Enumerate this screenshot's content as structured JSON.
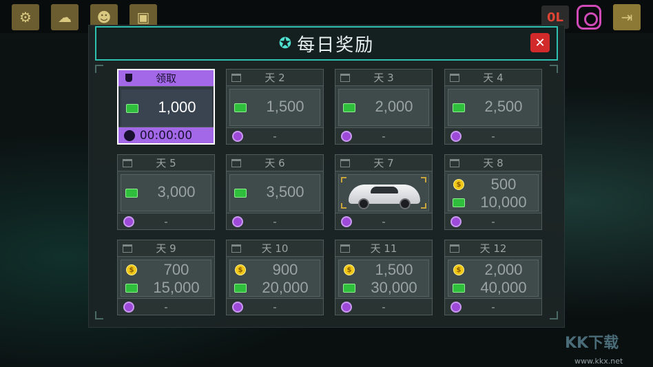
{
  "title": "每日奖励",
  "top_bar": {
    "counter_text": "0L"
  },
  "cards": [
    {
      "label": "领取",
      "amounts": [
        "1,000"
      ],
      "foot": "00:00:00"
    },
    {
      "label": "天 2",
      "amounts": [
        "1,500"
      ],
      "foot": "-"
    },
    {
      "label": "天 3",
      "amounts": [
        "2,000"
      ],
      "foot": "-"
    },
    {
      "label": "天 4",
      "amounts": [
        "2,500"
      ],
      "foot": "-"
    },
    {
      "label": "天 5",
      "amounts": [
        "3,000"
      ],
      "foot": "-"
    },
    {
      "label": "天 6",
      "amounts": [
        "3,500"
      ],
      "foot": "-"
    },
    {
      "label": "天 7",
      "amounts": [],
      "foot": "-"
    },
    {
      "label": "天 8",
      "amounts": [
        "500",
        "10,000"
      ],
      "foot": "-"
    },
    {
      "label": "天 9",
      "amounts": [
        "700",
        "15,000"
      ],
      "foot": "-"
    },
    {
      "label": "天 10",
      "amounts": [
        "900",
        "20,000"
      ],
      "foot": "-"
    },
    {
      "label": "天 11",
      "amounts": [
        "1,500",
        "30,000"
      ],
      "foot": "-"
    },
    {
      "label": "天 12",
      "amounts": [
        "2,000",
        "40,000"
      ],
      "foot": "-"
    }
  ],
  "watermark": {
    "brand": "KK下载",
    "url": "www.kkx.net"
  },
  "colors": {
    "accent": "#2ec0b0",
    "active": "#a368e8",
    "close": "#d22a2a",
    "cash": "#2fbf3c",
    "coin": "#f2c818"
  }
}
